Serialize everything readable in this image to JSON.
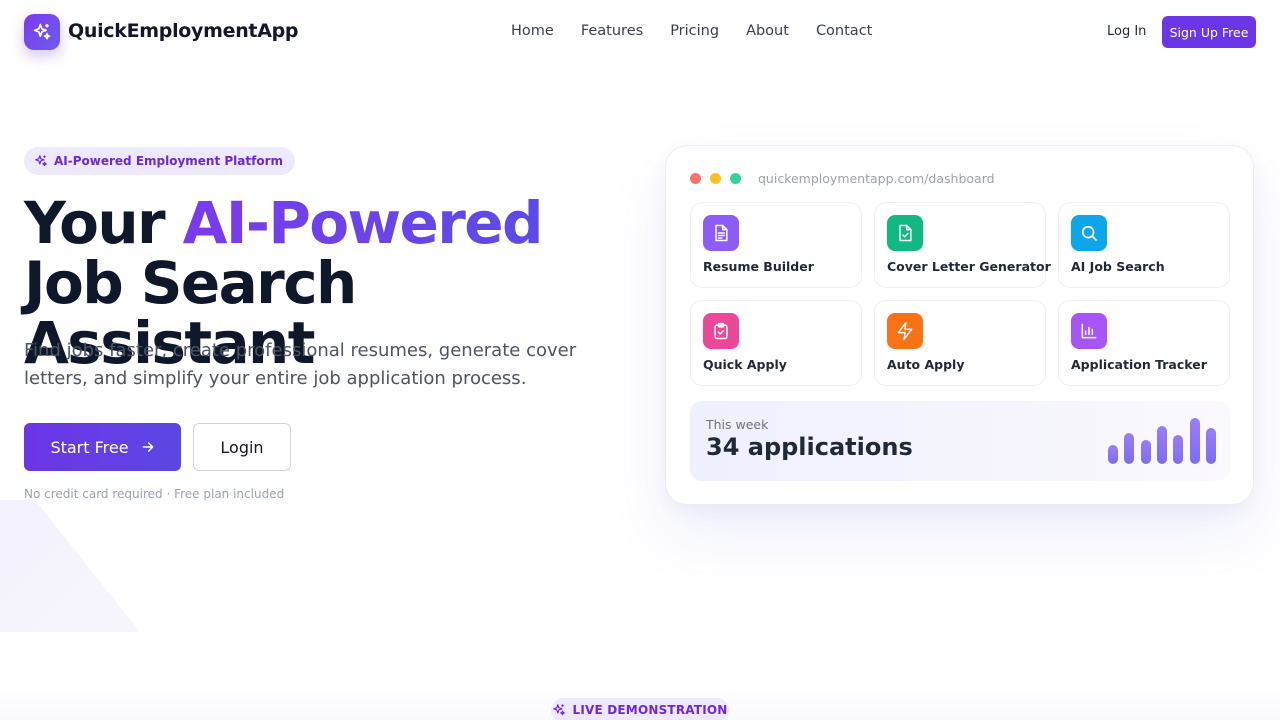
{
  "nav": {
    "brand": "QuickEmploymentApp",
    "links": [
      "Home",
      "Features",
      "Pricing",
      "About",
      "Contact"
    ],
    "login": "Log In",
    "signup": "Sign Up Free"
  },
  "hero": {
    "badge": "AI-Powered Employment Platform",
    "headline_pre": "Your ",
    "headline_highlight": "AI-Powered",
    "headline_post": " Job Search Assistant",
    "subtitle": "Find jobs faster, create professional resumes, generate cover letters, and simplify your entire job application process.",
    "start_button": "Start Free",
    "login_button": "Login",
    "note": "No credit card required · Free plan included"
  },
  "dashboard": {
    "url": "quickemploymentapp.com/dashboard",
    "tiles": [
      {
        "label": "Resume Builder",
        "icon": "document-icon",
        "color": "#8b5cf6"
      },
      {
        "label": "Cover Letter Generator",
        "icon": "file-check-icon",
        "color": "#10b981"
      },
      {
        "label": "AI Job Search",
        "icon": "search-icon",
        "color": "#0ea5e9"
      },
      {
        "label": "Quick Apply",
        "icon": "clipboard-check-icon",
        "color": "#ec4899"
      },
      {
        "label": "Auto Apply",
        "icon": "lightning-icon",
        "color": "#f97316"
      },
      {
        "label": "Application Tracker",
        "icon": "bar-chart-icon",
        "color": "#a855f7"
      }
    ],
    "week_label": "This week",
    "week_value": "34 applications",
    "mini_bars": [
      0.4,
      0.66,
      0.51,
      0.81,
      0.62,
      0.98,
      0.77
    ]
  },
  "live_badge": "LIVE DEMONSTRATION",
  "colors": {
    "accent": "#6d35e8",
    "badge_bg": "#ede9fe",
    "badge_text": "#6d28d9",
    "dot_red": "#f87171",
    "dot_yellow": "#fbbf24",
    "dot_green": "#34d399"
  }
}
